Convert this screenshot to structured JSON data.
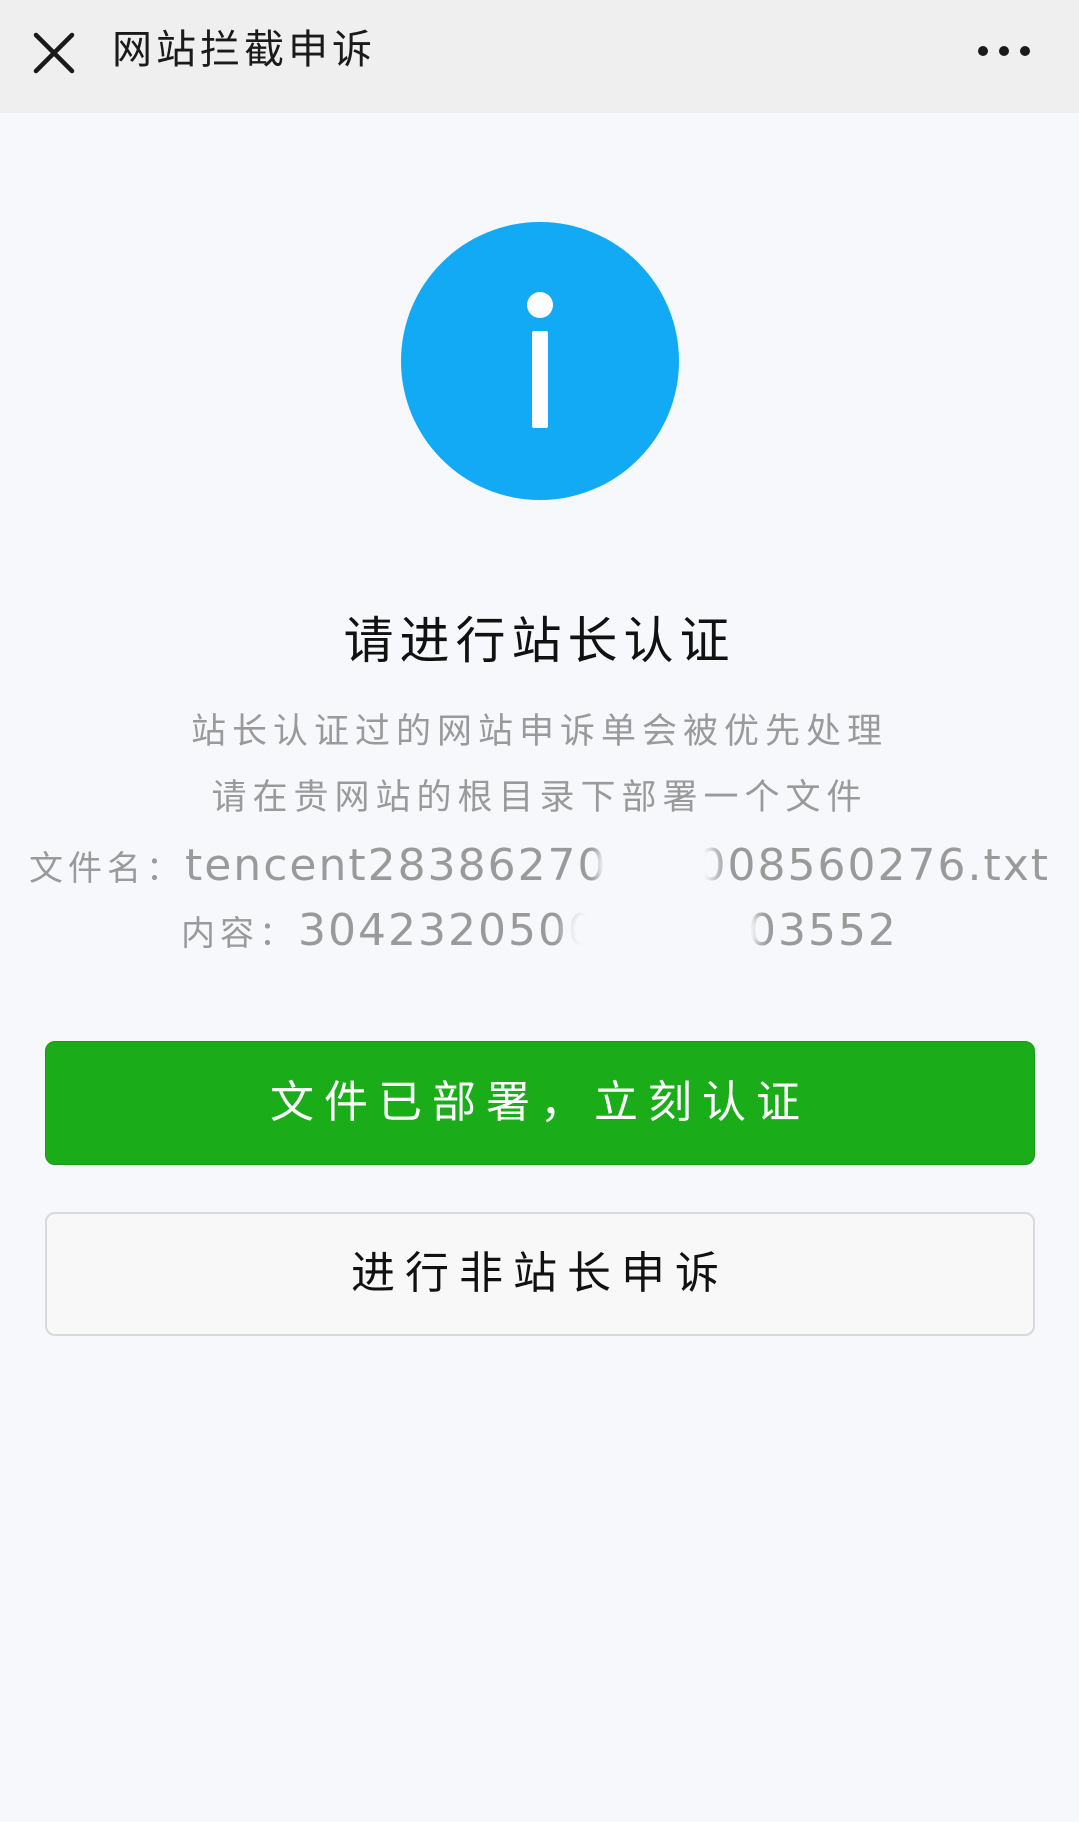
{
  "topbar": {
    "title": "网站拦截申诉",
    "close_icon": "close-icon",
    "more_icon": "more-horizontal-icon"
  },
  "status": {
    "icon": "info-icon",
    "icon_color": "#12aaf5"
  },
  "main": {
    "heading": "请进行站长认证",
    "desc_line1": "站长认证过的网站申诉单会被优先处理",
    "desc_line2": "请在贵网站的根目录下部署一个文件",
    "file_label": "文件名：",
    "file_value": "tencent28386270000008560276.txt",
    "content_label": "内容：",
    "content_value": "30423205000000003552"
  },
  "actions": {
    "primary_label": "文件已部署，立刻认证",
    "primary_color": "#1aad19",
    "secondary_label": "进行非站长申诉"
  }
}
